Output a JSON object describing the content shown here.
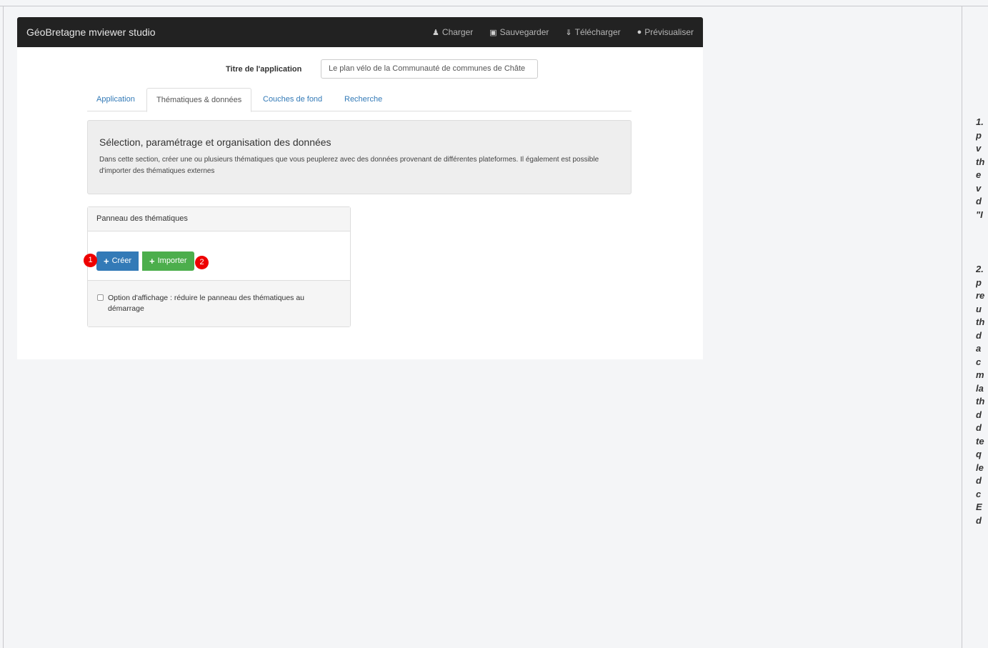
{
  "navbar": {
    "brand": "GéoBretagne mviewer studio",
    "actions": [
      {
        "icon": "user-icon",
        "label": "Charger"
      },
      {
        "icon": "save-icon",
        "label": "Sauvegarder"
      },
      {
        "icon": "download-icon",
        "label": "Télécharger"
      },
      {
        "icon": "globe-icon",
        "label": "Prévisualiser"
      }
    ]
  },
  "title_field": {
    "label": "Titre de l'application",
    "value": "Le plan vélo de la Communauté de communes de Châte"
  },
  "tabs": [
    {
      "label": "Application",
      "active": false
    },
    {
      "label": "Thématiques & données",
      "active": true
    },
    {
      "label": "Couches de fond",
      "active": false
    },
    {
      "label": "Recherche",
      "active": false
    }
  ],
  "section": {
    "title": "Sélection, paramétrage et organisation des données",
    "description": "Dans cette section, créer une ou plusieurs thématiques que vous peuplerez avec des données provenant de différentes plateformes. Il également est possible d'importer des thématiques externes"
  },
  "panel": {
    "heading": "Panneau des thématiques",
    "create_label": "Créer",
    "import_label": "Importer",
    "marker_create": "1",
    "marker_import": "2",
    "option_label": "Option d'affichage : réduire le panneau des thématiques au démarrage",
    "option_checked": false
  },
  "side_notes": {
    "note1_lines": [
      "1.",
      "p",
      "v",
      "th",
      "e",
      "v",
      "d",
      "\"I"
    ],
    "note2_lines": [
      "2.",
      "p",
      "re",
      "u",
      "th",
      "d",
      "a",
      "c",
      "m",
      "la",
      "th",
      "d",
      "d",
      "te",
      "q",
      "le",
      "d",
      "c",
      "E",
      "d"
    ]
  },
  "colors": {
    "navbar_bg": "#222222",
    "primary": "#337ab7",
    "success": "#4cae4c",
    "marker": "#ee0000"
  }
}
